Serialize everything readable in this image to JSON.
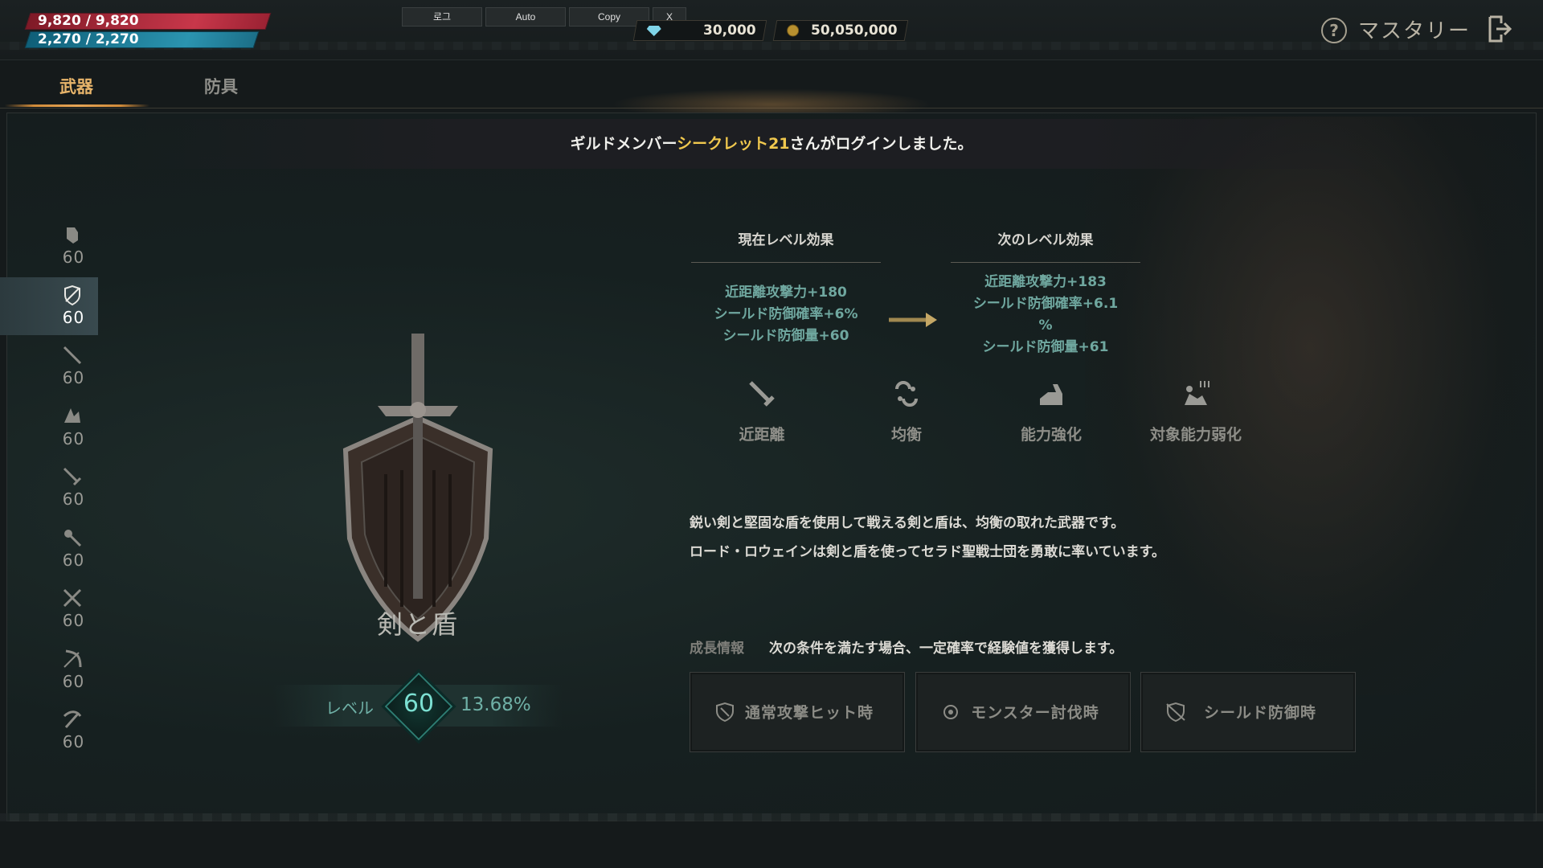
{
  "status": {
    "hp": "9,820 / 9,820",
    "mp": "2,270 / 2,270"
  },
  "toolbar": {
    "btn1": "로그",
    "btn2": "Auto",
    "btn3": "Copy",
    "btn4": "X"
  },
  "currency": {
    "gems": "30,000",
    "gold": "50,050,000"
  },
  "header": {
    "title": "マスタリー",
    "help": "?"
  },
  "tabs": {
    "weapon": "武器",
    "armor": "防具"
  },
  "notice": {
    "prefix": "ギルドメンバー",
    "name": "シークレット21",
    "suffix": "さんがログインしました。"
  },
  "sidebar": {
    "items": [
      {
        "icon": "gauntlet-icon",
        "level": "60"
      },
      {
        "icon": "sword-and-shield-icon",
        "level": "60",
        "selected": true
      },
      {
        "icon": "staff-icon",
        "level": "60"
      },
      {
        "icon": "claw-icon",
        "level": "60"
      },
      {
        "icon": "dagger-icon",
        "level": "60"
      },
      {
        "icon": "wand-icon",
        "level": "60"
      },
      {
        "icon": "dual-blades-icon",
        "level": "60"
      },
      {
        "icon": "bow-icon",
        "level": "60"
      },
      {
        "icon": "crossbow-icon",
        "level": "60"
      }
    ]
  },
  "weapon": {
    "name": "剣と盾",
    "level_label": "レベル",
    "level": "60",
    "progress": "13.68%"
  },
  "effects": {
    "current_title": "現在レベル効果",
    "next_title": "次のレベル効果",
    "current": [
      "近距離攻撃力+180",
      "シールド防御確率+6%",
      "シールド防御量+60"
    ],
    "next": [
      "近距離攻撃力+183",
      "シールド防御確率+6.1",
      "%",
      "シールド防御量+61"
    ]
  },
  "attributes": [
    {
      "icon": "melee-icon",
      "label": "近距離"
    },
    {
      "icon": "balance-icon",
      "label": "均衡"
    },
    {
      "icon": "buff-icon",
      "label": "能力強化"
    },
    {
      "icon": "debuff-icon",
      "label": "対象能力弱化"
    }
  ],
  "description": [
    "鋭い剣と堅固な盾を使用して戦える剣と盾は、均衡の取れた武器です。",
    "ロード・ロウェインは剣と盾を使ってセラド聖戦士団を勇敢に率いています。"
  ],
  "growth": {
    "label": "成長情報",
    "text": "次の条件を満たす場合、一定確率で経験値を獲得します。",
    "conditions": [
      {
        "icon": "shield-hit-icon",
        "label": "通常攻撃ヒット時"
      },
      {
        "icon": "target-icon",
        "label": "モンスター討伐時"
      },
      {
        "icon": "shield-block-icon",
        "label": "シールド防御時"
      }
    ]
  },
  "colors": {
    "hp": "#c8374a",
    "mp": "#2b94b0",
    "accent": "#e7b46a",
    "highlight": "#f0c84e",
    "effect": "#6fa79f"
  }
}
